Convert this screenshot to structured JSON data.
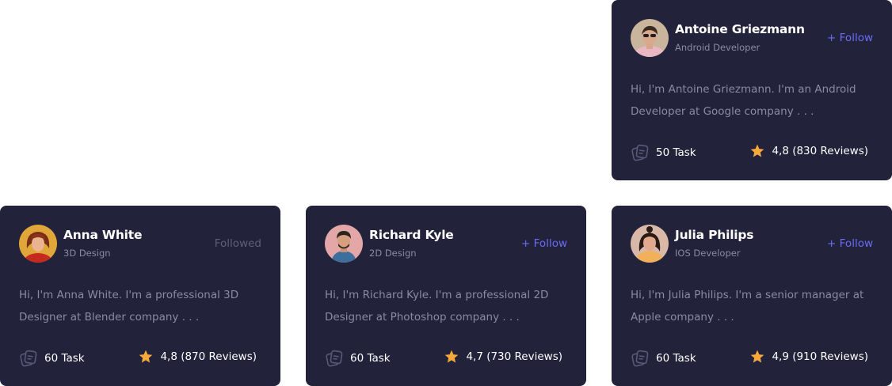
{
  "colors": {
    "card_bg": "#22223a",
    "accent": "#6a6cf6",
    "muted": "#8a8aa3",
    "followed": "#5f5f78",
    "star": "#f6a93b"
  },
  "cards": [
    {
      "name": "Antoine Griezmann",
      "role": "Android Developer",
      "follow_label": "+ Follow",
      "followed": false,
      "bio": "Hi, I'm Antoine Griezmann. I'm an Android Developer at Google company . . .",
      "task_label": "50 Task",
      "rating_label": "4,8 (830 Reviews)",
      "task_icon": "task-icon",
      "rating_icon": "star-icon"
    },
    {
      "name": "Anna White",
      "role": "3D Design",
      "follow_label": "Followed",
      "followed": true,
      "bio": "Hi, I'm Anna White. I'm a professional 3D Designer at Blender company . . .",
      "task_label": "60 Task",
      "rating_label": "4,8 (870 Reviews)",
      "task_icon": "task-icon",
      "rating_icon": "star-icon"
    },
    {
      "name": "Richard Kyle",
      "role": "2D Design",
      "follow_label": "+ Follow",
      "followed": false,
      "bio": "Hi, I'm Richard Kyle. I'm a professional 2D Designer at Photoshop company . . .",
      "task_label": "60 Task",
      "rating_label": "4,7 (730 Reviews)",
      "task_icon": "task-icon",
      "rating_icon": "star-icon"
    },
    {
      "name": "Julia Philips",
      "role": "IOS Developer",
      "follow_label": "+ Follow",
      "followed": false,
      "bio": "Hi, I'm Julia Philips. I'm a senior manager at Apple company . . .",
      "task_label": "60 Task",
      "rating_label": "4,9 (910 Reviews)",
      "task_icon": "task-icon",
      "rating_icon": "star-icon"
    }
  ]
}
